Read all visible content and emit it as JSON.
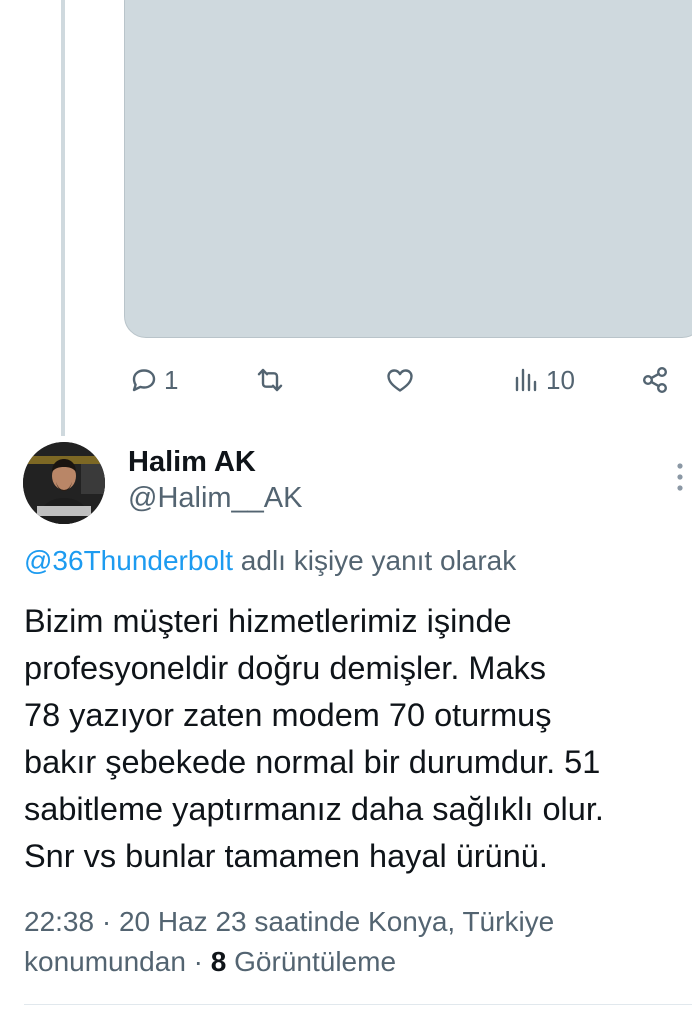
{
  "parent_tweet": {
    "actions": {
      "reply_count": "1",
      "retweet_count": "",
      "like_count": "",
      "views_count": "10"
    }
  },
  "tweet": {
    "author": {
      "name": "Halim AK",
      "handle": "@Halim__AK"
    },
    "reply_to": {
      "mention": "@36Thunderbolt",
      "suffix": " adlı kişiye yanıt olarak"
    },
    "text_lines": [
      "Bizim müşteri hizmetlerimiz işinde",
      "profesyoneldir doğru demişler. Maks",
      "78 yazıyor zaten modem 70 oturmuş",
      "bakır şebekede normal bir durumdur. 51",
      "sabitleme yaptırmanız daha sağlıklı olur.",
      "Snr vs bunlar tamamen hayal ürünü."
    ],
    "meta": {
      "line1": "22:38 · 20 Haz 23 saatinde Konya, Türkiye",
      "line2_prefix": "konumundan · ",
      "views_count": "8",
      "views_label": " Görüntüleme"
    }
  },
  "icons": {
    "reply": "reply-icon",
    "retweet": "retweet-icon",
    "like": "heart-icon",
    "views": "views-chart-icon",
    "share": "share-icon",
    "more": "more-vertical-icon"
  },
  "colors": {
    "text_primary": "#0f1419",
    "text_secondary": "#536471",
    "link": "#1d9bf0",
    "media_placeholder": "#cfd9de",
    "thread_line": "#cfd9de"
  }
}
